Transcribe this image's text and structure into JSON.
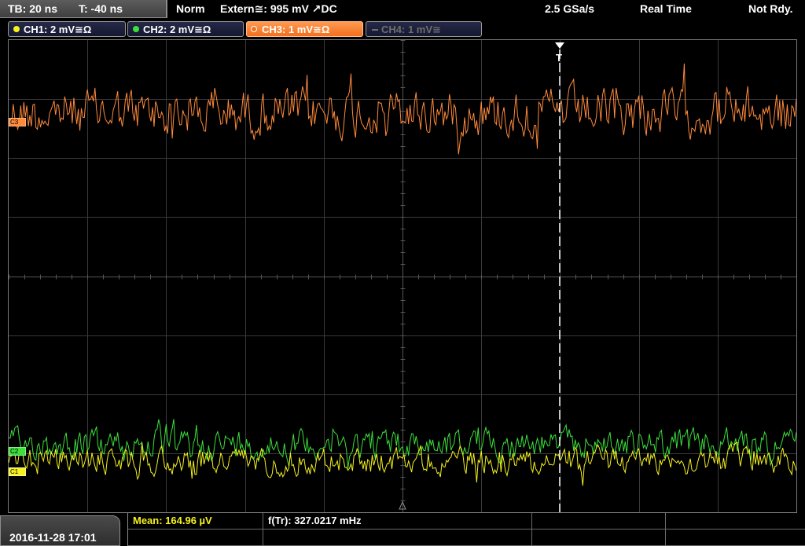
{
  "status": {
    "timebase": "TB: 20 ns",
    "trigger_offset": "T: -40 ns",
    "trigger_mode": "Norm",
    "trigger_source": "Extern≅: 995 mV ↗DC",
    "sample_rate": "2.5 GSa/s",
    "acq_mode": "Real Time",
    "state": "Not Rdy."
  },
  "channels": [
    {
      "label": "CH1: 2 mV≅Ω",
      "color": "#f5f21e",
      "state": "on"
    },
    {
      "label": "CH2: 2 mV≅Ω",
      "color": "#3be03b",
      "state": "on"
    },
    {
      "label": "CH3: 1 mV≅Ω",
      "color": "#ff8a3c",
      "state": "selected"
    },
    {
      "label": "CH4: 1 mV≅",
      "color": "#6e6e6e",
      "state": "off"
    }
  ],
  "markers": {
    "ch3": "C3",
    "ch2": "C2",
    "ch1": "C1",
    "trigger": "T"
  },
  "measurements": {
    "mean": "Mean: 164.96 µV",
    "freq": "f(Tr): 327.0217 mHz"
  },
  "datetime": "2016-11-28 17:01",
  "colors": {
    "ch1": "#f5f21e",
    "ch2": "#3be03b",
    "ch3": "#ff8a3c",
    "grid": "#3a3a3a",
    "background": "#000000"
  }
}
